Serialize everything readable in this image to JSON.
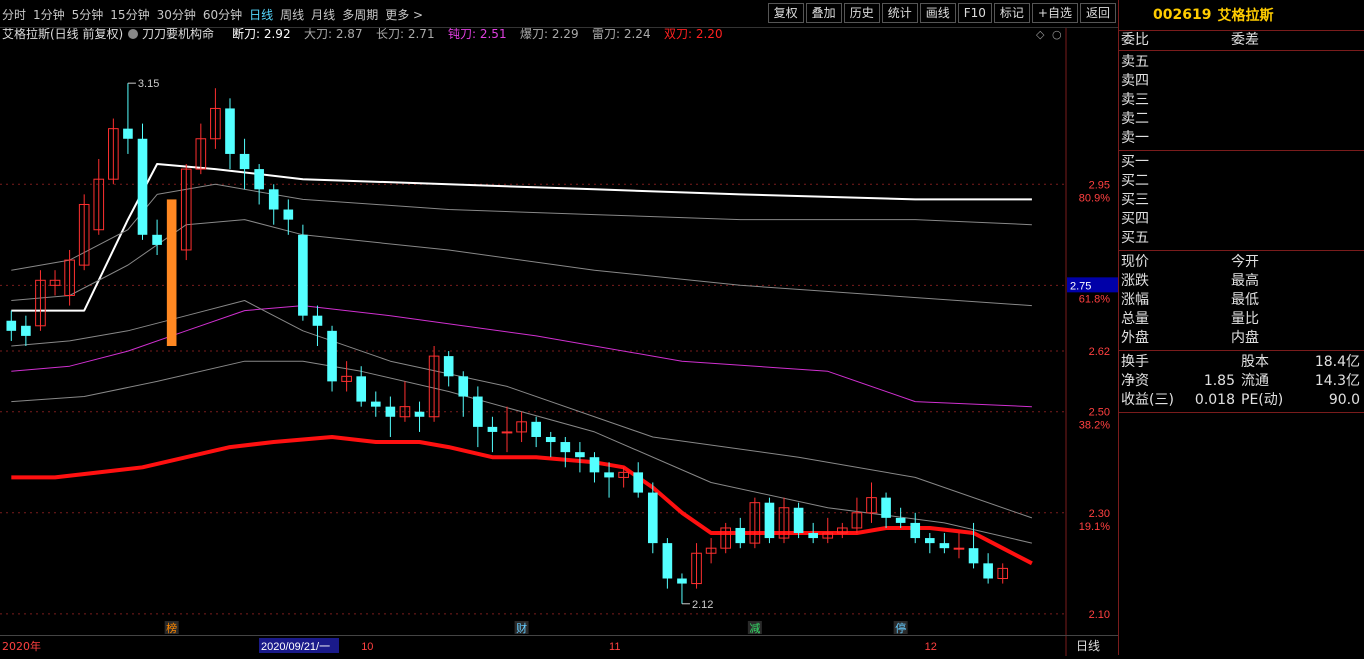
{
  "toolbar": {
    "periods": [
      "分时",
      "1分钟",
      "5分钟",
      "15分钟",
      "30分钟",
      "60分钟",
      "日线",
      "周线",
      "月线",
      "多周期",
      "更多 >"
    ],
    "active_period": "日线",
    "tools": [
      "复权",
      "叠加",
      "历史",
      "统计",
      "画线",
      "F10",
      "标记",
      "+自选",
      "返回"
    ]
  },
  "chart": {
    "title": "艾格拉斯(日线 前复权)",
    "indicator_name": "刀刀要机构命",
    "indicators": [
      {
        "label": "断刀:",
        "value": "2.92",
        "color": "#ffffff"
      },
      {
        "label": "大刀:",
        "value": "2.87",
        "color": "#aaaaaa"
      },
      {
        "label": "长刀:",
        "value": "2.71",
        "color": "#aaaaaa"
      },
      {
        "label": "钝刀:",
        "value": "2.51",
        "color": "#e040e0"
      },
      {
        "label": "爆刀:",
        "value": "2.29",
        "color": "#aaaaaa"
      },
      {
        "label": "雷刀:",
        "value": "2.24",
        "color": "#aaaaaa"
      },
      {
        "label": "双刀:",
        "value": "2.20",
        "color": "#ff2020"
      }
    ],
    "price_axis": [
      {
        "price": "2.95",
        "pct": "80.9%"
      },
      {
        "price": "2.75",
        "pct": "61.8%"
      },
      {
        "price": "2.62",
        "pct": ""
      },
      {
        "price": "2.50",
        "pct": "38.2%"
      },
      {
        "price": "2.30",
        "pct": "19.1%"
      },
      {
        "price": "2.10",
        "pct": ""
      }
    ],
    "current_price_tag": "2.75",
    "high_label": "3.15",
    "low_label": "2.12",
    "event_markers": [
      {
        "text": "榜",
        "color": "#ff8800"
      },
      {
        "text": "财",
        "color": "#66ccff"
      },
      {
        "text": "减",
        "color": "#33dd66"
      },
      {
        "text": "停",
        "color": "#66ccff"
      }
    ],
    "date_labels": [
      "2020年",
      "2020/09/21/一",
      "10",
      "11",
      "12"
    ],
    "bottom_label": "日线",
    "colors": {
      "up": "#ff3030",
      "down": "#54ffff",
      "highlight": "#ff8822",
      "ma_main": "#ff1010"
    }
  },
  "chart_data": {
    "type": "candlestick",
    "ylim": [
      2.08,
      3.18
    ],
    "candles": [
      [
        2.68,
        2.66,
        2.7,
        2.64
      ],
      [
        2.67,
        2.65,
        2.69,
        2.63
      ],
      [
        2.67,
        2.76,
        2.78,
        2.66
      ],
      [
        2.75,
        2.76,
        2.78,
        2.73
      ],
      [
        2.73,
        2.8,
        2.82,
        2.71
      ],
      [
        2.79,
        2.91,
        2.93,
        2.78
      ],
      [
        2.86,
        2.96,
        3.0,
        2.85
      ],
      [
        2.96,
        3.06,
        3.08,
        2.95
      ],
      [
        3.06,
        3.04,
        3.15,
        3.01
      ],
      [
        3.04,
        2.85,
        3.07,
        2.84
      ],
      [
        2.85,
        2.83,
        2.88,
        2.81
      ],
      [
        2.83,
        2.82,
        2.84,
        2.77
      ],
      [
        2.82,
        2.98,
        2.99,
        2.8
      ],
      [
        2.98,
        3.04,
        3.07,
        2.97
      ],
      [
        3.04,
        3.1,
        3.14,
        3.02
      ],
      [
        3.1,
        3.01,
        3.12,
        2.98
      ],
      [
        3.01,
        2.98,
        3.04,
        2.94
      ],
      [
        2.98,
        2.94,
        2.99,
        2.91
      ],
      [
        2.94,
        2.9,
        2.95,
        2.87
      ],
      [
        2.9,
        2.88,
        2.92,
        2.85
      ],
      [
        2.85,
        2.69,
        2.87,
        2.68
      ],
      [
        2.69,
        2.67,
        2.71,
        2.63
      ],
      [
        2.66,
        2.56,
        2.67,
        2.54
      ],
      [
        2.56,
        2.57,
        2.6,
        2.54
      ],
      [
        2.57,
        2.52,
        2.59,
        2.51
      ],
      [
        2.52,
        2.51,
        2.54,
        2.49
      ],
      [
        2.51,
        2.49,
        2.53,
        2.45
      ],
      [
        2.49,
        2.51,
        2.56,
        2.48
      ],
      [
        2.5,
        2.49,
        2.52,
        2.46
      ],
      [
        2.49,
        2.61,
        2.63,
        2.48
      ],
      [
        2.61,
        2.57,
        2.62,
        2.55
      ],
      [
        2.57,
        2.53,
        2.58,
        2.49
      ],
      [
        2.53,
        2.47,
        2.55,
        2.43
      ],
      [
        2.47,
        2.46,
        2.49,
        2.42
      ],
      [
        2.46,
        2.46,
        2.51,
        2.42
      ],
      [
        2.46,
        2.48,
        2.5,
        2.44
      ],
      [
        2.48,
        2.45,
        2.49,
        2.43
      ],
      [
        2.45,
        2.44,
        2.46,
        2.41
      ],
      [
        2.44,
        2.42,
        2.45,
        2.39
      ],
      [
        2.42,
        2.41,
        2.44,
        2.38
      ],
      [
        2.41,
        2.38,
        2.42,
        2.36
      ],
      [
        2.38,
        2.37,
        2.4,
        2.33
      ],
      [
        2.37,
        2.38,
        2.39,
        2.35
      ],
      [
        2.38,
        2.34,
        2.4,
        2.33
      ],
      [
        2.34,
        2.24,
        2.36,
        2.22
      ],
      [
        2.24,
        2.17,
        2.25,
        2.15
      ],
      [
        2.17,
        2.16,
        2.18,
        2.12
      ],
      [
        2.16,
        2.22,
        2.24,
        2.15
      ],
      [
        2.22,
        2.23,
        2.25,
        2.2
      ],
      [
        2.23,
        2.27,
        2.28,
        2.22
      ],
      [
        2.27,
        2.24,
        2.29,
        2.23
      ],
      [
        2.24,
        2.32,
        2.33,
        2.23
      ],
      [
        2.32,
        2.25,
        2.33,
        2.24
      ],
      [
        2.25,
        2.31,
        2.33,
        2.24
      ],
      [
        2.31,
        2.26,
        2.32,
        2.25
      ],
      [
        2.26,
        2.25,
        2.28,
        2.24
      ],
      [
        2.25,
        2.26,
        2.29,
        2.24
      ],
      [
        2.26,
        2.27,
        2.28,
        2.25
      ],
      [
        2.27,
        2.3,
        2.33,
        2.26
      ],
      [
        2.3,
        2.33,
        2.36,
        2.28
      ],
      [
        2.33,
        2.29,
        2.34,
        2.27
      ],
      [
        2.29,
        2.28,
        2.31,
        2.27
      ],
      [
        2.28,
        2.25,
        2.3,
        2.24
      ],
      [
        2.25,
        2.24,
        2.26,
        2.22
      ],
      [
        2.24,
        2.23,
        2.26,
        2.22
      ],
      [
        2.23,
        2.23,
        2.26,
        2.21
      ],
      [
        2.23,
        2.2,
        2.28,
        2.19
      ],
      [
        2.2,
        2.17,
        2.22,
        2.16
      ],
      [
        2.17,
        2.19,
        2.2,
        2.16
      ]
    ],
    "lines": [
      {
        "name": "断刀",
        "color": "#ffffff",
        "width": 2,
        "points": [
          [
            0,
            2.7
          ],
          [
            5,
            2.7
          ],
          [
            8,
            2.88
          ],
          [
            10,
            2.99
          ],
          [
            14,
            2.98
          ],
          [
            20,
            2.96
          ],
          [
            30,
            2.95
          ],
          [
            40,
            2.94
          ],
          [
            50,
            2.93
          ],
          [
            62,
            2.92
          ],
          [
            70,
            2.92
          ]
        ]
      },
      {
        "name": "大刀",
        "color": "#888888",
        "width": 1,
        "points": [
          [
            0,
            2.78
          ],
          [
            4,
            2.8
          ],
          [
            8,
            2.86
          ],
          [
            10,
            2.93
          ],
          [
            14,
            2.95
          ],
          [
            20,
            2.92
          ],
          [
            30,
            2.9
          ],
          [
            40,
            2.89
          ],
          [
            50,
            2.88
          ],
          [
            62,
            2.88
          ],
          [
            70,
            2.87
          ]
        ]
      },
      {
        "name": "长刀",
        "color": "#888888",
        "width": 1,
        "points": [
          [
            0,
            2.72
          ],
          [
            4,
            2.73
          ],
          [
            8,
            2.79
          ],
          [
            12,
            2.87
          ],
          [
            16,
            2.88
          ],
          [
            20,
            2.85
          ],
          [
            30,
            2.82
          ],
          [
            40,
            2.78
          ],
          [
            50,
            2.75
          ],
          [
            60,
            2.73
          ],
          [
            70,
            2.71
          ]
        ]
      },
      {
        "name": "钝刀",
        "color": "#d030d0",
        "width": 1,
        "points": [
          [
            0,
            2.58
          ],
          [
            4,
            2.59
          ],
          [
            8,
            2.62
          ],
          [
            12,
            2.66
          ],
          [
            16,
            2.7
          ],
          [
            20,
            2.71
          ],
          [
            26,
            2.69
          ],
          [
            36,
            2.65
          ],
          [
            46,
            2.6
          ],
          [
            56,
            2.58
          ],
          [
            62,
            2.52
          ],
          [
            70,
            2.51
          ]
        ]
      },
      {
        "name": "爆刀",
        "color": "#888888",
        "width": 1,
        "points": [
          [
            0,
            2.63
          ],
          [
            4,
            2.64
          ],
          [
            8,
            2.66
          ],
          [
            12,
            2.69
          ],
          [
            16,
            2.72
          ],
          [
            20,
            2.66
          ],
          [
            26,
            2.6
          ],
          [
            34,
            2.55
          ],
          [
            44,
            2.45
          ],
          [
            54,
            2.41
          ],
          [
            62,
            2.37
          ],
          [
            70,
            2.29
          ]
        ]
      },
      {
        "name": "雷刀",
        "color": "#888888",
        "width": 1,
        "points": [
          [
            0,
            2.52
          ],
          [
            5,
            2.53
          ],
          [
            10,
            2.56
          ],
          [
            16,
            2.6
          ],
          [
            20,
            2.6
          ],
          [
            24,
            2.58
          ],
          [
            30,
            2.54
          ],
          [
            40,
            2.46
          ],
          [
            48,
            2.36
          ],
          [
            56,
            2.31
          ],
          [
            64,
            2.28
          ],
          [
            70,
            2.24
          ]
        ]
      },
      {
        "name": "双刀",
        "color": "#ff1010",
        "width": 4,
        "points": [
          [
            0,
            2.37
          ],
          [
            3,
            2.37
          ],
          [
            6,
            2.38
          ],
          [
            9,
            2.39
          ],
          [
            12,
            2.41
          ],
          [
            15,
            2.43
          ],
          [
            18,
            2.44
          ],
          [
            22,
            2.45
          ],
          [
            25,
            2.44
          ],
          [
            28,
            2.44
          ],
          [
            30,
            2.43
          ],
          [
            33,
            2.41
          ],
          [
            36,
            2.41
          ],
          [
            40,
            2.4
          ],
          [
            42,
            2.39
          ],
          [
            44,
            2.35
          ],
          [
            46,
            2.3
          ],
          [
            48,
            2.26
          ],
          [
            50,
            2.26
          ],
          [
            55,
            2.26
          ],
          [
            58,
            2.26
          ],
          [
            60,
            2.27
          ],
          [
            63,
            2.27
          ],
          [
            66,
            2.26
          ],
          [
            68,
            2.23
          ],
          [
            70,
            2.2
          ]
        ]
      }
    ]
  },
  "panel": {
    "code": "002619",
    "name": "艾格拉斯",
    "order_header": [
      "委比",
      "委差"
    ],
    "sell": [
      "卖五",
      "卖四",
      "卖三",
      "卖二",
      "卖一"
    ],
    "buy": [
      "买一",
      "买二",
      "买三",
      "买四",
      "买五"
    ],
    "quote_rows": [
      [
        "现价",
        "今开"
      ],
      [
        "涨跌",
        "最高"
      ],
      [
        "涨幅",
        "最低"
      ],
      [
        "总量",
        "量比"
      ],
      [
        "外盘",
        "内盘"
      ]
    ],
    "fund_rows": [
      {
        "k1": "换手",
        "v1": "",
        "k2": "股本",
        "v2": "18.4亿"
      },
      {
        "k1": "净资",
        "v1": "1.85",
        "k2": "流通",
        "v2": "14.3亿"
      },
      {
        "k1": "收益(三)",
        "v1": "0.018",
        "k2": "PE(动)",
        "v2": "90.0"
      }
    ]
  }
}
